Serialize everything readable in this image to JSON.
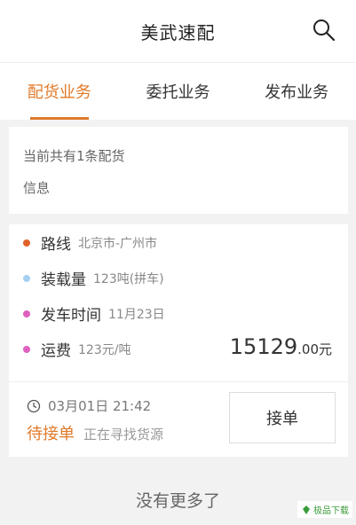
{
  "header": {
    "title": "美武速配",
    "search_icon": "search-icon"
  },
  "tabs": [
    {
      "label": "配货业务",
      "active": true
    },
    {
      "label": "委托业务",
      "active": false
    },
    {
      "label": "发布业务",
      "active": false
    }
  ],
  "info": {
    "line1": "当前共有1条配货",
    "line2": "信息"
  },
  "order": {
    "route_label": "路线",
    "route_value": "北京市-广州市",
    "load_label": "装载量",
    "load_value": "123吨(拼车)",
    "depart_label": "发车时间",
    "depart_value": "11月23日",
    "fee_label": "运费",
    "fee_value": "123元/吨",
    "price_main": "15129",
    "price_tail": ".00元",
    "time": "03月01日 21:42",
    "status": "待接单",
    "status_sub": "正在寻找货源",
    "accept_label": "接单",
    "colors": {
      "route": "#e0622a",
      "load": "#a8d0f0",
      "depart": "#e060c0",
      "fee": "#e060c0"
    }
  },
  "footer": {
    "text": "没有更多了"
  },
  "watermark": {
    "text": "极品下载"
  },
  "colors": {
    "accent": "#e07a2a"
  }
}
